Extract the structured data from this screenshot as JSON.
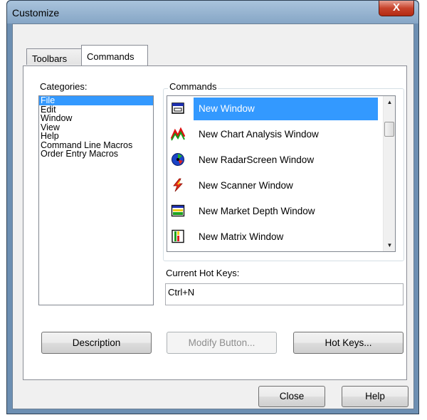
{
  "window": {
    "title": "Customize",
    "close_glyph": "X"
  },
  "tabs": [
    {
      "label": "Toolbars",
      "active": false
    },
    {
      "label": "Commands",
      "active": true
    }
  ],
  "categories": {
    "label": "Categories:",
    "items": [
      "File",
      "Edit",
      "Window",
      "View",
      "Help",
      "Command Line Macros",
      "Order Entry Macros"
    ],
    "selected": "File"
  },
  "commands": {
    "label": "Commands",
    "items": [
      {
        "label": "New Window",
        "icon": "window-icon",
        "selected": true
      },
      {
        "label": "New Chart Analysis Window",
        "icon": "chart-analysis-icon",
        "selected": false
      },
      {
        "label": "New RadarScreen Window",
        "icon": "radarscreen-icon",
        "selected": false
      },
      {
        "label": "New Scanner Window",
        "icon": "scanner-lightning-icon",
        "selected": false
      },
      {
        "label": "New Market Depth Window",
        "icon": "market-depth-icon",
        "selected": false
      },
      {
        "label": "New Matrix Window",
        "icon": "matrix-icon",
        "selected": false
      }
    ]
  },
  "hotkeys": {
    "label": "Current Hot Keys:",
    "value": "Ctrl+N"
  },
  "buttons": {
    "description": "Description",
    "modify": "Modify Button...",
    "hotkeys": "Hot Keys...",
    "close": "Close",
    "help": "Help"
  },
  "colors": {
    "selection": "#3399ff",
    "title_bar": "#86a6c6",
    "close_button": "#c7432c"
  }
}
